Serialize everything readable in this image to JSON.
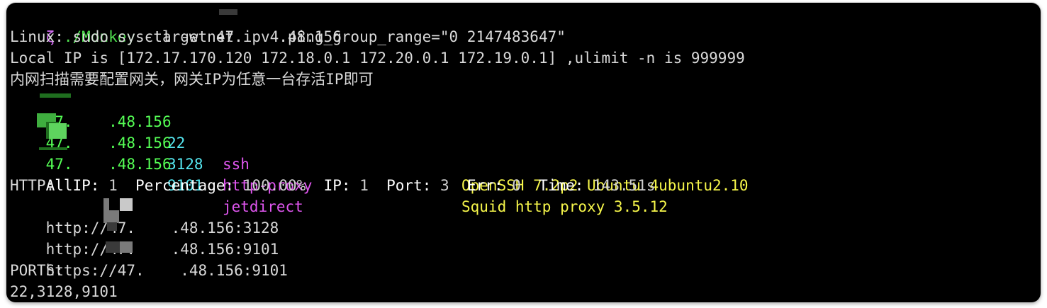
{
  "terminal": {
    "prompt_symbol": "ζ",
    "command": "./Monkey",
    "command_args": " -target 47.",
    "command_ip_tail": ".48.156",
    "lines": {
      "sysctl": "Linux: sudo sysctl -w net.ipv4.ping_group_range=\"0 2147483647\"",
      "local_ip": "Local IP is [172.17.170.120 172.18.0.1 172.20.0.1 172.19.0.1] ,ulimit -n is 999999",
      "hint": "内网扫描需要配置网关，网关IP为任意一台存活IP即可"
    },
    "results": [
      {
        "ip_prefix": "47.",
        "ip_suffix": ".48.156",
        "port": "22",
        "service": "ssh",
        "version": "OpenSSH 7.2p2 Ubuntu 4ubuntu2.10"
      },
      {
        "ip_prefix": "47.",
        "ip_suffix": ".48.156",
        "port": "3128",
        "service": "http-proxy",
        "version": "Squid http proxy 3.5.12"
      },
      {
        "ip_prefix": "47.",
        "ip_suffix": ".48.156",
        "port": "9101",
        "service": "jetdirect",
        "version": ""
      }
    ],
    "summary": {
      "allip_label": "AllIP:",
      "allip_value": "1",
      "percentage_label": "Percentage:",
      "percentage_value": "100.00%",
      "ip_label": "IP:",
      "ip_value": "1",
      "port_label": "Port:",
      "port_value": "3",
      "err_label": "Err:",
      "err_value": "0",
      "time_label": "Time:",
      "time_value": "143.51s"
    },
    "http_header": "HTTP:",
    "http_urls": [
      {
        "prefix": "http://47.",
        "suffix": ".48.156:3128"
      },
      {
        "prefix": "http://47.",
        "suffix": ".48.156:9101"
      },
      {
        "prefix": "https://47.",
        "suffix": ".48.156:9101"
      }
    ],
    "ports_header": "PORTS:",
    "ports_list": "22,3128,9101"
  },
  "colors": {
    "background": "#000000",
    "prompt": "#d16cf0",
    "command": "#4fe04f",
    "ip": "#55ff55",
    "port": "#55e6f0",
    "service": "#e056f0",
    "version": "#f6f64a"
  }
}
